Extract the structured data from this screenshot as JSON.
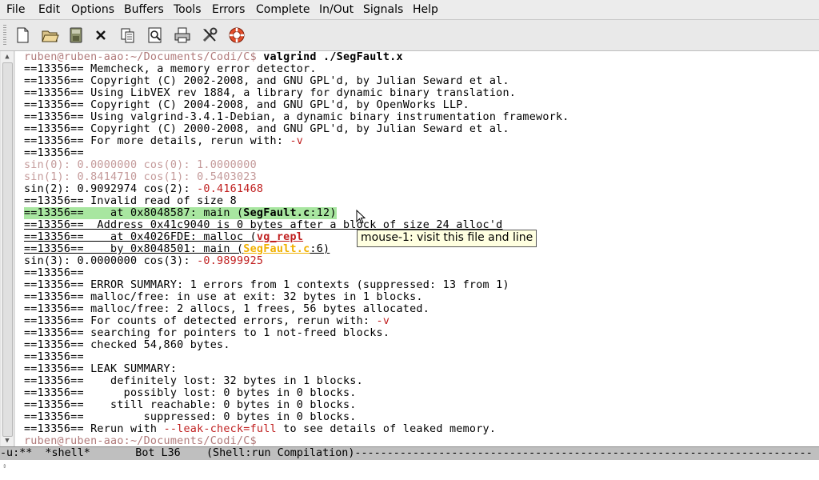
{
  "menu": [
    "File",
    "Edit",
    "Options",
    "Buffers",
    "Tools",
    "Errors",
    "Complete",
    "In/Out",
    "Signals",
    "Help"
  ],
  "toolbar": [
    {
      "name": "new-file-icon"
    },
    {
      "name": "open-folder-icon"
    },
    {
      "name": "save-icon"
    },
    {
      "name": "close-icon"
    },
    {
      "name": "copy-icon"
    },
    {
      "name": "search-icon"
    },
    {
      "name": "print-icon"
    },
    {
      "name": "preferences-icon"
    },
    {
      "name": "help-icon"
    }
  ],
  "shell": {
    "prompt1": "ruben@ruben-aao:~/Documents/Codi/C$",
    "command": " valgrind ./SegFault.x",
    "lines": [
      {
        "text": "==13356== Memcheck, a memory error detector."
      },
      {
        "text": "==13356== Copyright (C) 2002-2008, and GNU GPL'd, by Julian Seward et al."
      },
      {
        "text": "==13356== Using LibVEX rev 1884, a library for dynamic binary translation."
      },
      {
        "text": "==13356== Copyright (C) 2004-2008, and GNU GPL'd, by OpenWorks LLP."
      },
      {
        "text": "==13356== Using valgrind-3.4.1-Debian, a dynamic binary instrumentation framework."
      },
      {
        "text": "==13356== Copyright (C) 2000-2008, and GNU GPL'd, by Julian Seward et al."
      },
      {
        "text": "==13356== For more details, rerun with: ",
        "red": "-v"
      },
      {
        "text": "==13356=="
      },
      {
        "text": "sin(0): 0.0000000 cos(0): 1.0000000",
        "style": "faded"
      },
      {
        "text": "sin(1): 0.8414710 cos(1): 0.5403023",
        "style": "faded"
      },
      {
        "text": "sin(2): 0.9092974 cos(2): ",
        "red": "-0.4161468"
      },
      {
        "text": "==13356== Invalid read of size 8"
      }
    ],
    "hl_line": {
      "pre": "==13356==    at 0x8048587: main (",
      "file": "SegFault.c",
      "post": ":12)"
    },
    "addr_line": "==13356==  Address 0x41c9040 is 0 bytes after a block of size 24 alloc'd",
    "malloc_line": {
      "pre": "==13356==    at 0x4026FDE: malloc (",
      "file": "vg_repl"
    },
    "by_line": {
      "pre": "==13356==    by 0x8048501: main (",
      "file": "SegFault.c",
      "post": ":6)"
    },
    "lines2": [
      {
        "text": "sin(3): 0.0000000 cos(3): ",
        "red": "-0.9899925"
      },
      {
        "text": "==13356=="
      },
      {
        "text": "==13356== ERROR SUMMARY: 1 errors from 1 contexts (suppressed: 13 from 1)"
      },
      {
        "text": "==13356== malloc/free: in use at exit: 32 bytes in 1 blocks."
      },
      {
        "text": "==13356== malloc/free: 2 allocs, 1 frees, 56 bytes allocated."
      },
      {
        "text": "==13356== For counts of detected errors, rerun with: ",
        "red": "-v"
      },
      {
        "text": "==13356== searching for pointers to 1 not-freed blocks."
      },
      {
        "text": "==13356== checked 54,860 bytes."
      },
      {
        "text": "==13356=="
      },
      {
        "text": "==13356== LEAK SUMMARY:"
      },
      {
        "text": "==13356==    definitely lost: 32 bytes in 1 blocks."
      },
      {
        "text": "==13356==      possibly lost: 0 bytes in 0 blocks."
      },
      {
        "text": "==13356==    still reachable: 0 bytes in 0 blocks."
      },
      {
        "text": "==13356==         suppressed: 0 bytes in 0 blocks."
      },
      {
        "text": "==13356== Rerun with ",
        "red": "--leak-check=full",
        "post": " to see details of leaked memory."
      }
    ],
    "prompt2": "ruben@ruben-aao:~/Documents/Codi/C$"
  },
  "tooltip": "mouse-1: visit this file and line",
  "modeline": "-u:**  *shell*       Bot L36    (Shell:run Compilation)-----------------------------------------------------------------------",
  "colors": {
    "accent_red": "#c02020",
    "highlight": "#a8e6a0",
    "link": "#f0b000",
    "prompt": "#b07a7a"
  }
}
